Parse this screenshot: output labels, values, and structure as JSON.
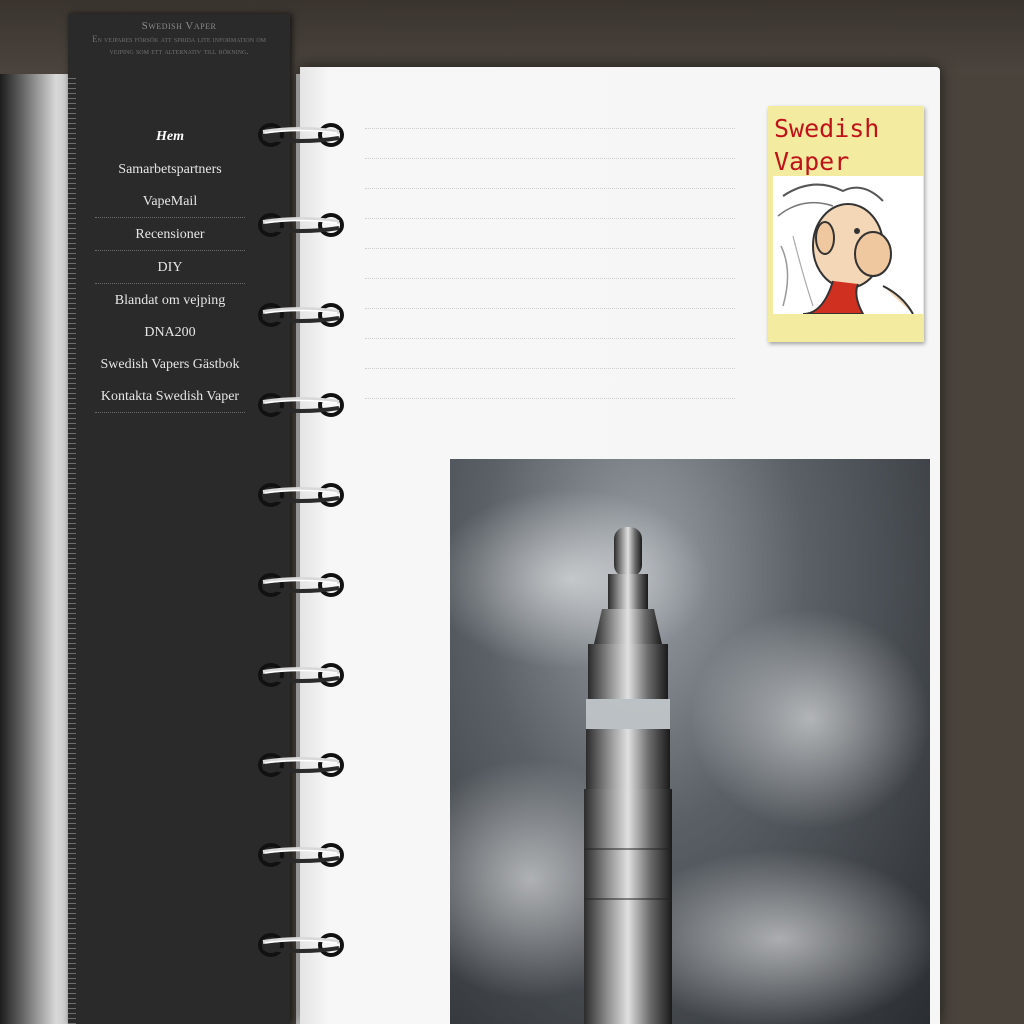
{
  "site": {
    "title": "Swedish Vaper",
    "tagline": "En vejpares försök att sprida lite information om vejping som ett alternativ till rökning."
  },
  "nav": {
    "items": [
      {
        "label": "Hem",
        "active": true
      },
      {
        "label": "Samarbetspartners"
      },
      {
        "label": "VapeMail"
      },
      {
        "label": "Recensioner"
      },
      {
        "label": "DIY"
      },
      {
        "label": "Blandat om vejping"
      },
      {
        "label": "DNA200"
      },
      {
        "label": "Swedish Vapers Gästbok"
      },
      {
        "label": "Kontakta Swedish Vaper"
      }
    ]
  },
  "sticky_note": {
    "line1": "Swedish",
    "line2": "Vaper",
    "image": "cartoon-old-man"
  },
  "main_image": "vape-device-in-smoke",
  "colors": {
    "background": "#4a433c",
    "sidebar": "#2a2a2a",
    "page": "#f6f6f6",
    "sticky": "#f3eca0",
    "sticky_text": "#c0121a"
  }
}
